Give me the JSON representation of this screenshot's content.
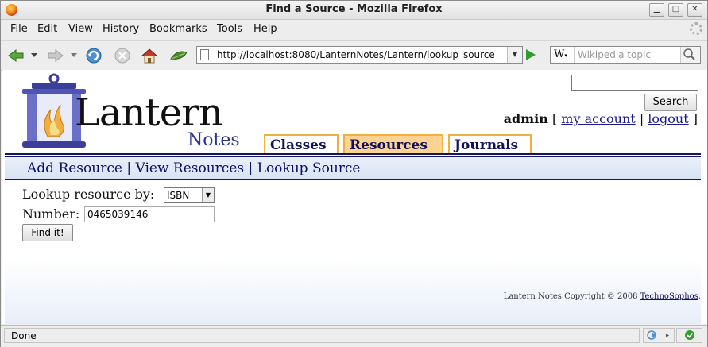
{
  "window": {
    "title": "Find a Source - Mozilla Firefox"
  },
  "menu": [
    {
      "key": "F",
      "rest": "ile"
    },
    {
      "key": "E",
      "rest": "dit"
    },
    {
      "key": "V",
      "rest": "iew"
    },
    {
      "key": "H",
      "rest": "istory"
    },
    {
      "key": "B",
      "rest": "ookmarks"
    },
    {
      "key": "T",
      "rest": "ools"
    },
    {
      "key": "H",
      "rest": "elp"
    }
  ],
  "nav": {
    "url": "http://localhost:8080/LanternNotes/Lantern/lookup_source",
    "search_engine_letter": "W",
    "search_placeholder": "Wikipedia topic"
  },
  "site": {
    "logo_text": "Lantern",
    "logo_sub": "Notes",
    "search_button": "Search",
    "user": "admin",
    "bracket_open": "[",
    "my_account": "my account",
    "separator": "|",
    "logout": "logout",
    "bracket_close": "]",
    "tabs": [
      {
        "label": "Classes",
        "active": false
      },
      {
        "label": "Resources",
        "active": true
      },
      {
        "label": "Journals",
        "active": false
      }
    ],
    "subnav": {
      "add": "Add Resource",
      "view": "View Resources",
      "lookup": "Lookup Source",
      "sep": "|"
    }
  },
  "form": {
    "lookup_label": "Lookup resource by:",
    "lookup_value": "ISBN",
    "number_label": "Number:",
    "number_value": "0465039146",
    "submit": "Find it!"
  },
  "footer": {
    "copyright": "Lantern Notes Copyright © 2008",
    "link": "TechnoSophos",
    "period": "."
  },
  "status": {
    "text": "Done"
  },
  "colors": {
    "accent_navy": "#141464",
    "tab_border": "#f0b040",
    "tab_active_bg": "#fcd393"
  }
}
